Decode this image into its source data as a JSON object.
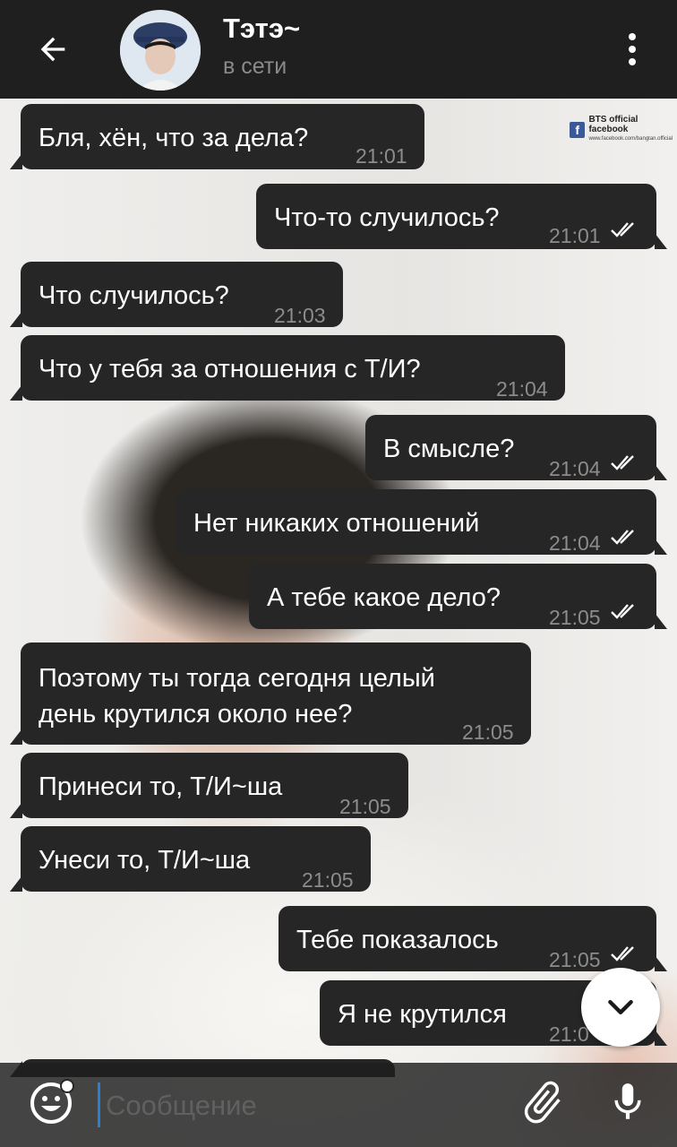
{
  "header": {
    "title": "Тэтэ~",
    "status": "в сети",
    "back_icon": "arrow-left-icon",
    "menu_icon": "more-vertical-icon"
  },
  "watermark": {
    "logo_letter": "f",
    "text": "BTS official facebook",
    "subtext": "www.facebook.com/bangtan.official"
  },
  "messages": [
    {
      "text": "Бля, хён, что за дела?",
      "time": "21:01",
      "direction": "in"
    },
    {
      "text": "Что-то случилось?",
      "time": "21:01",
      "direction": "out",
      "read": true
    },
    {
      "text": "Что случилось?",
      "time": "21:03",
      "direction": "in"
    },
    {
      "text": "Что у тебя за отношения с Т/И?",
      "time": "21:04",
      "direction": "in"
    },
    {
      "text": "В смысле?",
      "time": "21:04",
      "direction": "out",
      "read": true
    },
    {
      "text": "Нет никаких отношений",
      "time": "21:04",
      "direction": "out",
      "read": true
    },
    {
      "text": "А тебе какое дело?",
      "time": "21:05",
      "direction": "out",
      "read": true
    },
    {
      "text": "Поэтому ты тогда сегодня целый\nдень крутился около нее?",
      "time": "21:05",
      "direction": "in"
    },
    {
      "text": "Принеси то, Т/И~ша",
      "time": "21:05",
      "direction": "in"
    },
    {
      "text": "Унеси то, Т/И~ша",
      "time": "21:05",
      "direction": "in"
    },
    {
      "text": "Тебе показалось",
      "time": "21:05",
      "direction": "out",
      "read": true
    },
    {
      "text": "Я не крутился",
      "time": "21:0",
      "direction": "out",
      "read": true
    }
  ],
  "input": {
    "placeholder": "Сообщение",
    "emoji_icon": "emoji-icon",
    "attach_icon": "paperclip-icon",
    "mic_icon": "microphone-icon"
  },
  "scroll_down_icon": "chevron-down-icon",
  "colors": {
    "header_bg": "#1f1f1f",
    "bubble_bg": "#262626",
    "time_color": "#8c8c8c",
    "status_color": "#8a8a8a",
    "cursor_color": "#2a7fd4"
  }
}
